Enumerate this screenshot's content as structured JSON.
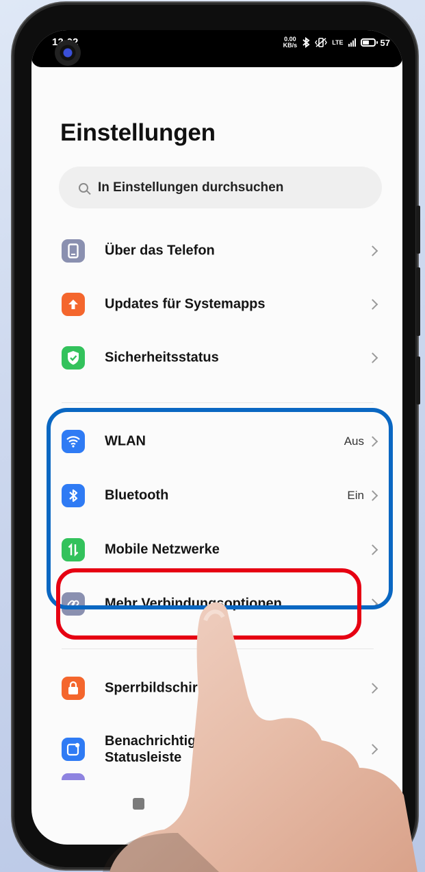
{
  "status_bar": {
    "time": "12:02",
    "speed_value": "0.00",
    "speed_unit": "KB/s",
    "network": "LTE",
    "battery": "57"
  },
  "page": {
    "title": "Einstellungen",
    "search_placeholder": "In Einstellungen durchsuchen"
  },
  "groups": [
    {
      "items": [
        {
          "label": "Über das Telefon",
          "value": "",
          "icon": "phone-icon",
          "color": "#8a90b0"
        },
        {
          "label": "Updates für Systemapps",
          "value": "",
          "icon": "arrow-up-icon",
          "color": "#f4662d"
        },
        {
          "label": "Sicherheitsstatus",
          "value": "",
          "icon": "shield-check-icon",
          "color": "#33c25c"
        }
      ]
    },
    {
      "items": [
        {
          "label": "WLAN",
          "value": "Aus",
          "icon": "wifi-icon",
          "color": "#2f7bf4"
        },
        {
          "label": "Bluetooth",
          "value": "Ein",
          "icon": "bluetooth-icon",
          "color": "#2f7bf4"
        },
        {
          "label": "Mobile Netzwerke",
          "value": "",
          "icon": "mobile-data-icon",
          "color": "#33c25c"
        },
        {
          "label": "Mehr Verbindungsoptionen",
          "value": "",
          "icon": "link-icon",
          "color": "#8a90b0"
        }
      ]
    },
    {
      "items": [
        {
          "label": "Sperrbildschirm",
          "value": "",
          "icon": "lock-icon",
          "color": "#f4662d"
        },
        {
          "label": "Benachrichtigungen und Statusleiste",
          "value": "",
          "icon": "notification-icon",
          "color": "#2f7bf4"
        }
      ]
    }
  ],
  "colors": {
    "highlight_outer": "#0a67c2",
    "highlight_inner": "#e60012"
  }
}
